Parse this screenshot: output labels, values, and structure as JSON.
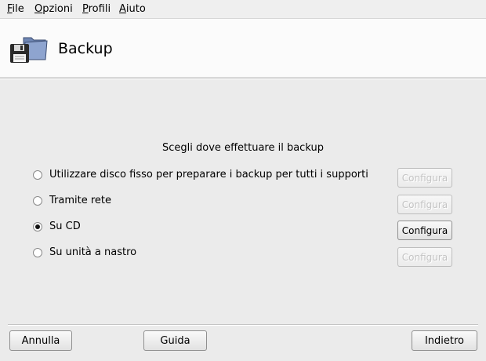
{
  "menubar": {
    "items": [
      {
        "accel": "F",
        "rest": "ile"
      },
      {
        "accel": "O",
        "rest": "pzioni"
      },
      {
        "accel": "P",
        "rest": "rofili"
      },
      {
        "accel": "A",
        "rest": "iuto"
      }
    ]
  },
  "header": {
    "title": "Backup",
    "icon": "backup-floppy-folder-icon"
  },
  "main": {
    "heading": "Scegli dove effettuare il backup",
    "options": [
      {
        "label": "Utilizzare disco fisso per preparare i backup per tutti i supporti",
        "selected": false,
        "button": "Configura",
        "button_enabled": false
      },
      {
        "label": "Tramite rete",
        "selected": false,
        "button": "Configura",
        "button_enabled": false
      },
      {
        "label": "Su CD",
        "selected": true,
        "button": "Configura",
        "button_enabled": true
      },
      {
        "label": "Su unità a nastro",
        "selected": false,
        "button": "Configura",
        "button_enabled": false
      }
    ]
  },
  "footer": {
    "cancel": "Annulla",
    "help": "Guida",
    "back": "Indietro"
  }
}
